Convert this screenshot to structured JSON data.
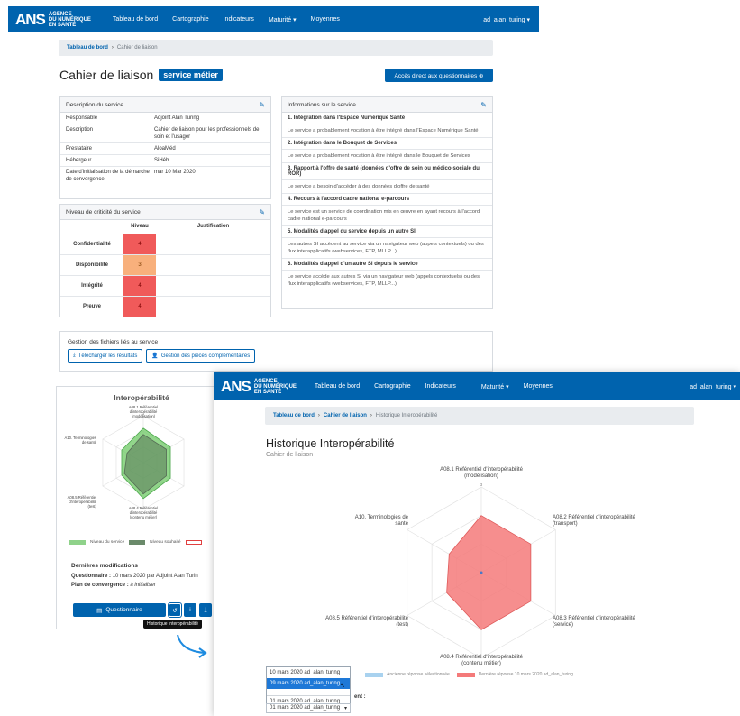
{
  "nav": {
    "logo_text": [
      "AGENCE",
      "DU NUMÉRIQUE",
      "EN SANTÉ"
    ],
    "links": [
      "Tableau de bord",
      "Cartographie",
      "Indicateurs",
      "Maturité ▾",
      "Moyennes"
    ],
    "user": "ad_alan_turing ▾"
  },
  "main": {
    "breadcrumb": {
      "link": "Tableau de bord",
      "sep": "›",
      "current": "Cahier de liaison"
    },
    "title": "Cahier de liaison",
    "badge": "service métier",
    "direct_button": "Accès direct aux questionnaires ⊕",
    "description": {
      "header": "Description du service",
      "rows": [
        {
          "k": "Responsable",
          "v": "Adjoint Alan Turing"
        },
        {
          "k": "Description",
          "v": "Cahier de liaison pour les professionnels de soin et l'usager"
        },
        {
          "k": "Prestataire",
          "v": "AloaMéd"
        },
        {
          "k": "Hébergeur",
          "v": "SiHéb"
        },
        {
          "k": "Date d'initialisation de la démarche de convergence",
          "v": "mar 10 Mar 2020"
        }
      ]
    },
    "criticite": {
      "header": "Niveau de criticité du service",
      "col_niveau": "Niveau",
      "col_justif": "Justification",
      "rows": [
        {
          "label": "Confidentialité",
          "level": "4"
        },
        {
          "label": "Disponibilité",
          "level": "3"
        },
        {
          "label": "Intégrité",
          "level": "4"
        },
        {
          "label": "Preuve",
          "level": "4"
        }
      ]
    },
    "infos": {
      "header": "Informations sur le service",
      "items": [
        {
          "title": "1. Intégration dans l'Espace Numérique Santé",
          "body": "Le service a probablement vocation à être intégré dans l'Espace Numérique Santé"
        },
        {
          "title": "2. Intégration dans le Bouquet de Services",
          "body": "Le service a probablement vocation à être intégré dans le Bouquet de Services"
        },
        {
          "title": "3. Rapport à l'offre de santé (données d'offre de soin ou médico-sociale du ROR)",
          "body": "Le service a besoin d'accéder à des données d'offre de santé"
        },
        {
          "title": "4. Recours à l'accord cadre national e-parcours",
          "body": "Le service est un service de coordination mis en œuvre en ayant recours à l'accord cadre national e-parcours"
        },
        {
          "title": "5. Modalités d'appel du service depuis un autre SI",
          "body": "Les autres SI accèdent au service via un navigateur web (appels contextuels) ou des flux interapplicatifs (webservices, FTP, MLLP...)"
        },
        {
          "title": "6. Modalités d'appel d'un autre SI depuis le service",
          "body": "Le service accède aux autres SI via un navigateur web (appels contextuels) ou des flux interapplicatifs (webservices, FTP, MLLP...)"
        }
      ]
    },
    "files": {
      "header": "Gestion des fichiers liés au service",
      "btn_download": "Télécharger les résultats",
      "btn_pieces": "Gestion des pièces complémentaires"
    },
    "interop_card": {
      "title": "Interopérabilité",
      "axis_labels": [
        "A08.1 Référentiel d'interopérabilité (modélisation)",
        "A08.2 (tr",
        "A08.3 (se",
        "A08.4 Référentiel d'interopérabilité (contenu métier)",
        "A08.5 Référentiel d'interopérabilité (test)",
        "A10. Terminologies de santé"
      ],
      "tick_top": "3",
      "legend": [
        "Niveau du service",
        "Niveau souhaité"
      ],
      "last_mod_title": "Dernières modifications",
      "questionnaire_label": "Questionnaire :",
      "questionnaire_value": "10 mars 2020 par Adjoint Alan Turin",
      "plan_label": "Plan de convergence :",
      "plan_value": "à initialiser",
      "btn_questionnaire": "Questionnaire",
      "tooltip": "Historique Interopérabilité",
      "chart_data": {
        "type": "radar",
        "categories": [
          "A08.1",
          "A08.2",
          "A08.3",
          "A08.4",
          "A08.5",
          "A10"
        ],
        "series": [
          {
            "name": "Niveau du service",
            "values": [
              2.2,
              2.0,
              2.0,
              2.3,
              1.6,
              1.6
            ]
          },
          {
            "name": "Niveau souhaité",
            "values": [
              1.8,
              1.7,
              1.7,
              2.0,
              1.4,
              1.2
            ]
          }
        ],
        "ylim": [
          0,
          3
        ]
      }
    }
  },
  "overlay": {
    "links": [
      "Tableau de bord",
      "Cartographie",
      "Indicateurs",
      "Maturité ▾",
      "Moyennes"
    ],
    "user": "ad_alan_turing ▾",
    "breadcrumb": {
      "a": "Tableau de bord",
      "b": "Cahier de liaison",
      "current": "Historique Interopérabilité"
    },
    "title": "Historique Interopérabilité",
    "subtitle": "Cahier de liaison",
    "axis_labels": [
      [
        "A08.1 Référentiel d'interopérabilité",
        "(modélisation)"
      ],
      [
        "A08.2 Référentiel d'interopérabilité",
        "(transport)"
      ],
      [
        "A08.3 Référentiel d'interopérabilité",
        "(service)"
      ],
      [
        "A08.4 Référentiel d'interopérabilité",
        "(contenu métier)"
      ],
      [
        "A08.5 Référentiel d'interopérabilité",
        "(test)"
      ],
      [
        "A10. Terminologies de",
        "santé"
      ]
    ],
    "tick_top": "3",
    "legend": [
      "Ancienne réponse sélectionnée",
      "Dernière réponse 10 mars 2020 ad_alan_turing"
    ],
    "dropdown_options": [
      "10 mars 2020 ad_alan_turing",
      "09 mars 2020 ad_alan_turing",
      "01 mars 2020 ad_alan_turing"
    ],
    "select_value": "01 mars 2020 ad_alan_turing",
    "partial_text": "ent :",
    "chart_data": {
      "type": "radar",
      "categories": [
        "A08.1",
        "A08.2",
        "A08.3",
        "A08.4",
        "A08.5",
        "A10"
      ],
      "series": [
        {
          "name": "Dernière réponse 10 mars 2020 ad_alan_turing",
          "values": [
            2.0,
            2.0,
            2.0,
            2.0,
            1.4,
            1.3
          ]
        }
      ],
      "ylim": [
        0,
        3
      ]
    },
    "colors": {
      "series": "#f47a7a",
      "old": "#a9d2ef"
    }
  }
}
